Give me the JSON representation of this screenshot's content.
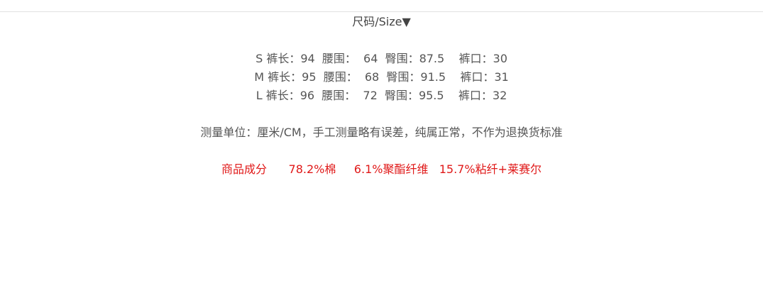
{
  "header": {
    "title": "尺码/Size▼"
  },
  "size_table": {
    "rows": [
      {
        "text": "S 裤长：94  腰围：  64  臀围：87.5    裤口：30"
      },
      {
        "text": "M 裤长：95  腰围：  68  臀围：91.5    裤口：31"
      },
      {
        "text": "L 裤长：96  腰围：  72  臀围：95.5    裤口：32"
      }
    ]
  },
  "note": "测量单位：厘米/CM，手工测量略有误差，纯属正常，不作为退换货标准",
  "composition": {
    "text": "商品成分      78.2%棉     6.1%聚酯纤维   15.7%粘纤+莱赛尔"
  },
  "colors": {
    "text": "#555555",
    "accent": "#e01818",
    "divider": "#e2e2e2"
  }
}
